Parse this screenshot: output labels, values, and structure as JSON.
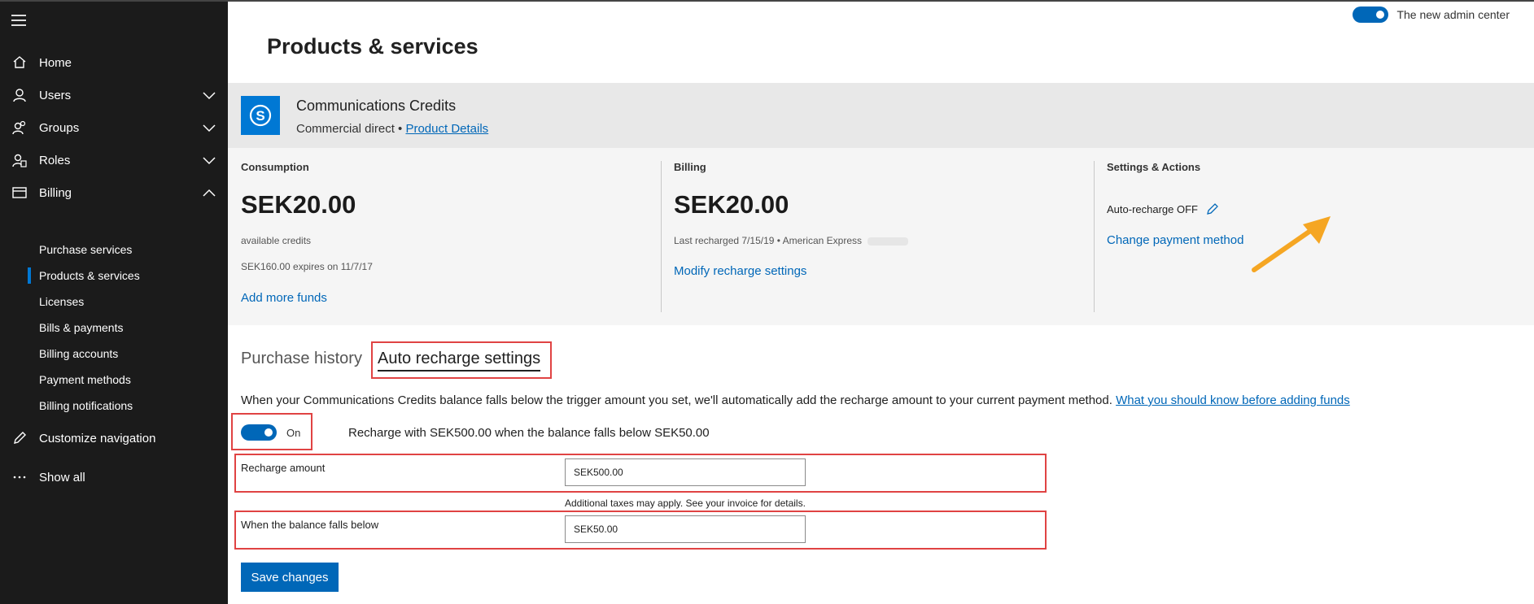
{
  "sidebar": {
    "menu_icon": "hamburger-icon",
    "items": [
      {
        "label": "Home",
        "icon": "home-icon"
      },
      {
        "label": "Users",
        "icon": "user-icon"
      },
      {
        "label": "Groups",
        "icon": "groups-icon"
      },
      {
        "label": "Roles",
        "icon": "roles-icon"
      },
      {
        "label": "Billing",
        "icon": "billing-icon"
      }
    ],
    "billing_sub": [
      "Purchase services",
      "Products & services",
      "Licenses",
      "Bills & payments",
      "Billing accounts",
      "Payment methods",
      "Billing notifications"
    ],
    "active_sub": "Products & services",
    "customize": "Customize navigation",
    "show_all": "Show all"
  },
  "header": {
    "title": "Products & services",
    "new_admin_label": "The new admin center",
    "new_admin_on": true
  },
  "product": {
    "name": "Communications Credits",
    "channel": "Commercial direct •",
    "details_link": "Product Details",
    "logo_icon": "skype-icon"
  },
  "consumption": {
    "heading": "Consumption",
    "amount": "SEK20.00",
    "sub": "available credits",
    "expiry": "SEK160.00 expires on 11/7/17",
    "link": "Add more funds"
  },
  "billing": {
    "heading": "Billing",
    "amount": "SEK20.00",
    "last_recharged": "Last recharged 7/15/19 • American Express",
    "link": "Modify recharge settings"
  },
  "settings": {
    "heading": "Settings & Actions",
    "auto_recharge": "Auto-recharge OFF",
    "link": "Change payment method"
  },
  "tabs": [
    {
      "label": "Purchase history",
      "active": false
    },
    {
      "label": "Auto recharge settings",
      "active": true
    }
  ],
  "auto_recharge": {
    "description": "When your Communications Credits balance falls below the trigger amount you set, we'll automatically add the recharge amount to your current payment method.",
    "description_link": "What you should know before adding funds",
    "toggle_label": "On",
    "toggle_on": true,
    "summary": "Recharge with SEK500.00 when the balance falls below SEK50.00",
    "recharge_label": "Recharge amount",
    "recharge_value": "SEK500.00",
    "tax_note": "Additional taxes may apply. See your invoice for details.",
    "threshold_label": "When the balance falls below",
    "threshold_value": "SEK50.00",
    "save_label": "Save changes"
  },
  "colors": {
    "accent": "#0067b8",
    "sidebar_bg": "#1b1b1b",
    "highlight": "#e04343",
    "arrow": "#f5a623"
  }
}
